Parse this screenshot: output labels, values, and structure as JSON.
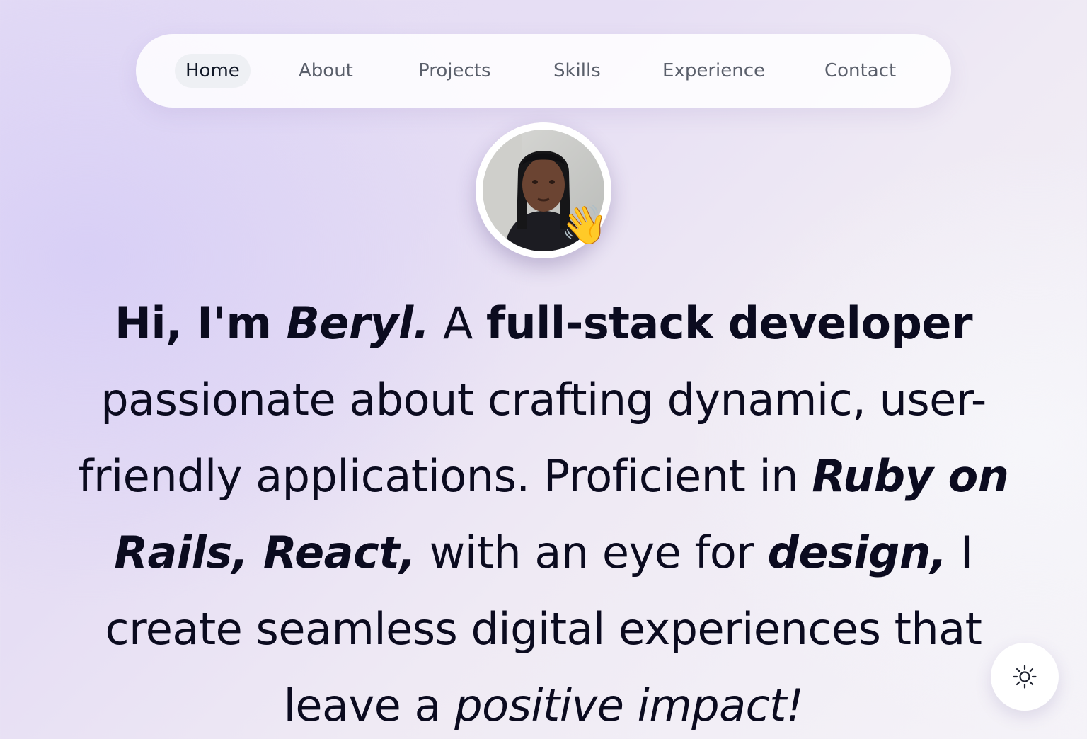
{
  "nav": {
    "items": [
      {
        "label": "Home",
        "active": true
      },
      {
        "label": "About",
        "active": false
      },
      {
        "label": "Projects",
        "active": false
      },
      {
        "label": "Skills",
        "active": false
      },
      {
        "label": "Experience",
        "active": false
      },
      {
        "label": "Contact",
        "active": false
      }
    ]
  },
  "hero": {
    "avatar_emoji": "👋",
    "text": {
      "p1": "Hi, I'm ",
      "name": "Beryl.",
      "p2": " A ",
      "role": "full-stack developer",
      "p3": " passionate about crafting dynamic, user-friendly applications. Proficient in ",
      "tech": "Ruby on Rails, React,",
      "p4": " with an eye for ",
      "design": "design,",
      "p5": " I create seamless digital experiences that leave a ",
      "impact": "positive impact!"
    }
  },
  "icons": {
    "avatar": "avatar-photo",
    "wave": "waving-hand-icon",
    "theme_toggle": "sun-icon"
  },
  "colors": {
    "text": "#0b0b1f",
    "nav_inactive": "#5a5f6b",
    "nav_active_bg": "#eef0f4"
  }
}
